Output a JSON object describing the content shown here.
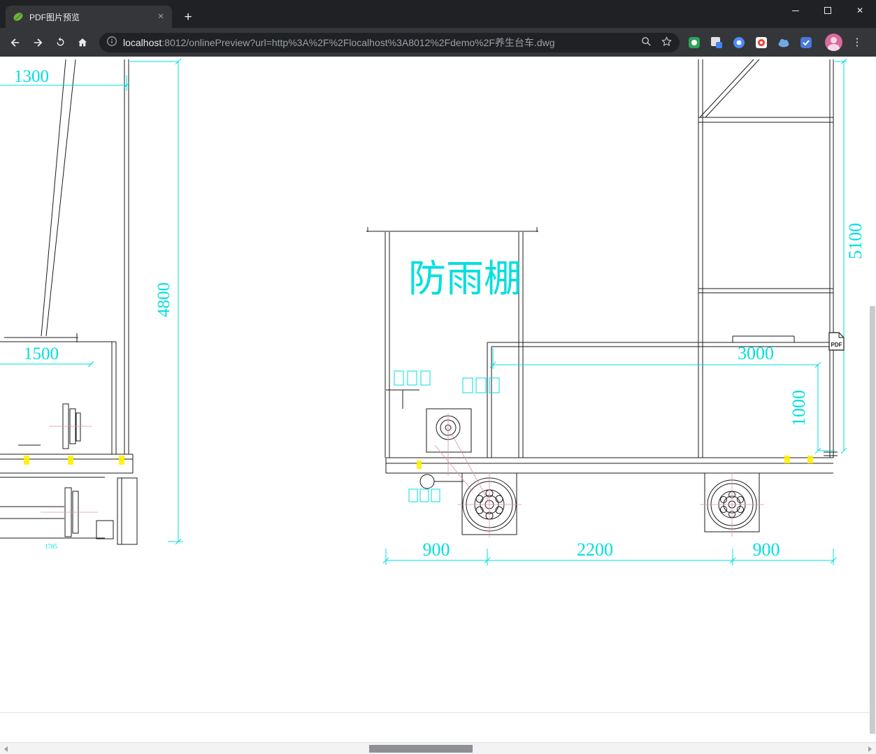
{
  "browser": {
    "tab_title": "PDF图片预览",
    "url_host": "localhost",
    "url_rest": ":8012/onlinePreview?url=http%3A%2F%2Flocalhost%3A8012%2Fdemo%2F养生台车.dwg"
  },
  "icons": {
    "new_tab": "+",
    "tab_close": "✕",
    "window_close": "✕",
    "menu_dots": "⋮"
  },
  "colors": {
    "dimension_cyan": "#00DFDF",
    "toolbar_dark": "#35363A",
    "frame_dark": "#202124",
    "highlight_yellow": "#FFF100"
  },
  "drawing": {
    "pdf_badge": "PDF",
    "labels": {
      "dim_width_top": "1300",
      "dim_height_left": "4800",
      "dim_platform": "1500",
      "dim_small": "1785",
      "canopy": "防雨棚",
      "dim_deck_length": "3000",
      "dim_deck_height": "1000",
      "dim_total_height": "5100",
      "dim_wheelbase_left": "900",
      "dim_wheelbase_center": "2200",
      "dim_wheelbase_right": "900"
    }
  }
}
